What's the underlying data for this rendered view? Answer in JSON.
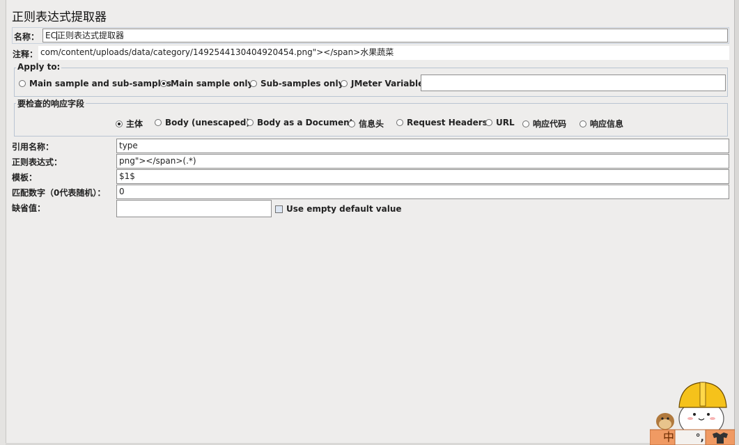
{
  "title": "正则表达式提取器",
  "name": {
    "label": "名称：",
    "value_before_caret": "EC",
    "value_after_caret": "正则表达式提取器"
  },
  "comment": {
    "label": "注释：",
    "value": "com/content/uploads/data/category/1492544130404920454.png\"></span>水果蔬菜"
  },
  "apply_to": {
    "legend": "Apply to:",
    "options": [
      "Main sample and sub-samples",
      "Main sample only",
      "Sub-samples only",
      "JMeter Variable"
    ],
    "selected": "Main sample only",
    "variable_value": ""
  },
  "response_field": {
    "legend": "要检查的响应字段",
    "options": [
      "主体",
      "Body (unescaped)",
      "Body as a Document",
      "信息头",
      "Request Headers",
      "URL",
      "响应代码",
      "响应信息"
    ],
    "selected": "主体"
  },
  "form": {
    "ref_name": {
      "label": "引用名称：",
      "value": "type"
    },
    "regex": {
      "label": "正则表达式：",
      "value": "png\"></span>(.*)"
    },
    "template": {
      "label": "模板：",
      "value": "$1$"
    },
    "match_no": {
      "label": "匹配数字（0代表随机）：",
      "value": "0"
    },
    "default": {
      "label": "缺省值：",
      "value": ""
    },
    "use_empty_default": {
      "label": "Use empty default value",
      "checked": false
    }
  },
  "ime_toolbar": {
    "items": [
      "中",
      "°,"
    ]
  },
  "colors": {
    "background": "#eeedec",
    "fieldset_border": "#b9c4d2",
    "field_border": "#8e8e8e"
  }
}
